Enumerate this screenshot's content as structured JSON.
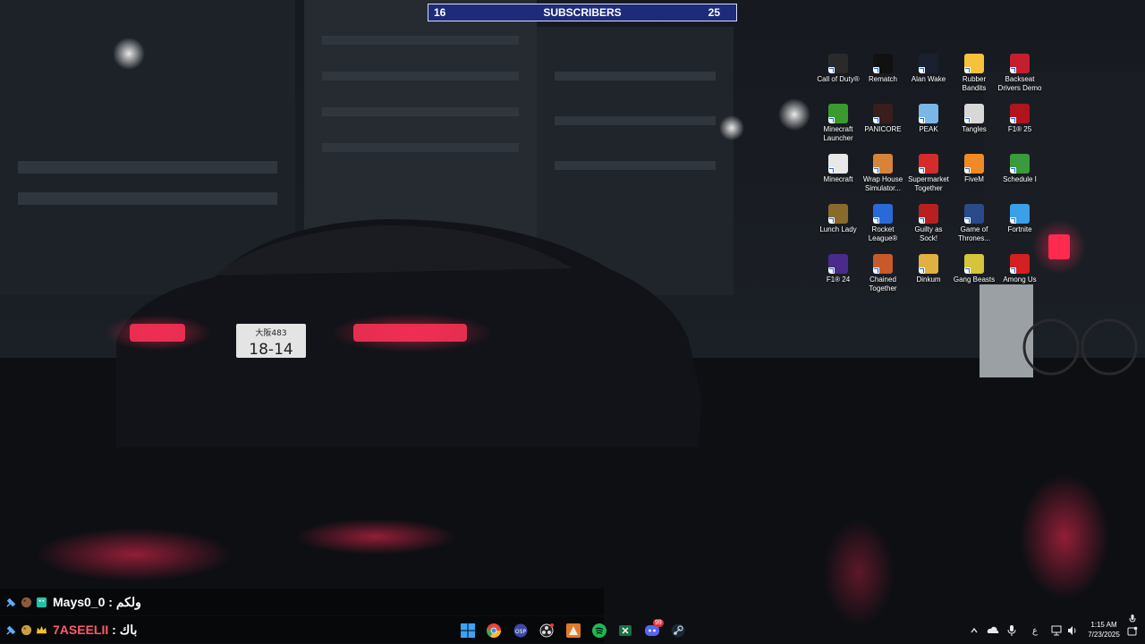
{
  "subscriber_goal": {
    "current": "16",
    "label": "SUBSCRIBERS",
    "target": "25"
  },
  "desktop_icons": [
    {
      "label": "Call of Duty®",
      "icon": "call-of-duty",
      "color": "#2a2a2a"
    },
    {
      "label": "Rematch",
      "icon": "unreal",
      "color": "#111111"
    },
    {
      "label": "Alan Wake",
      "icon": "alan-wake",
      "color": "#1a2030"
    },
    {
      "label": "Rubber Bandits",
      "icon": "rubber-bandits",
      "color": "#f5c23b"
    },
    {
      "label": "Backseat Drivers Demo",
      "icon": "backseat-drivers",
      "color": "#c51e2f"
    },
    {
      "label": "Minecraft Launcher",
      "icon": "minecraft",
      "color": "#3a9a2d"
    },
    {
      "label": "PANICORE",
      "icon": "panicore",
      "color": "#3a1d1d"
    },
    {
      "label": "PEAK",
      "icon": "peak",
      "color": "#7ab6e6"
    },
    {
      "label": "Tangles",
      "icon": "tangles",
      "color": "#d8d8d8"
    },
    {
      "label": "F1® 25",
      "icon": "f1-25",
      "color": "#b0141c"
    },
    {
      "label": "Minecraft",
      "icon": "file",
      "color": "#e8e8e8"
    },
    {
      "label": "Wrap House Simulator...",
      "icon": "wrap-house",
      "color": "#d7843a"
    },
    {
      "label": "Supermarket Together",
      "icon": "supermarket",
      "color": "#d62b2b"
    },
    {
      "label": "FiveM",
      "icon": "fivem",
      "color": "#f08a24"
    },
    {
      "label": "Schedule I",
      "icon": "schedule-i",
      "color": "#3b9a3b"
    },
    {
      "label": "Lunch Lady",
      "icon": "lunch-lady",
      "color": "#8a6a2a"
    },
    {
      "label": "Rocket League®",
      "icon": "rocket-league",
      "color": "#2a6ad8"
    },
    {
      "label": "Guilty as Sock!",
      "icon": "guilty-sock",
      "color": "#b82020"
    },
    {
      "label": "Game of Thrones...",
      "icon": "game-of-thrones",
      "color": "#2a4a8a"
    },
    {
      "label": "Fortnite",
      "icon": "fortnite",
      "color": "#3aa0e8"
    },
    {
      "label": "F1® 24",
      "icon": "f1-24",
      "color": "#4a2a8a"
    },
    {
      "label": "Chained Together",
      "icon": "chained-together",
      "color": "#c85a2a"
    },
    {
      "label": "Dinkum",
      "icon": "dinkum",
      "color": "#e0b040"
    },
    {
      "label": "Gang Beasts",
      "icon": "gang-beasts",
      "color": "#d6c43a"
    },
    {
      "label": "Among Us",
      "icon": "among-us",
      "color": "#d42020"
    }
  ],
  "chat": [
    {
      "user": "Mays0_0",
      "separator": " : ",
      "message": "ولكم"
    },
    {
      "user": "7ASEELII",
      "separator": " : ",
      "message": "باك"
    }
  ],
  "taskbar": {
    "apps": [
      "start",
      "chrome",
      "obs",
      "steam-alt",
      "blender",
      "spotify",
      "excel",
      "discord",
      "steam"
    ],
    "discord_badge": "99"
  },
  "tray": {
    "language": "ع",
    "time": "1:15 AM",
    "date": "7/23/2025"
  }
}
